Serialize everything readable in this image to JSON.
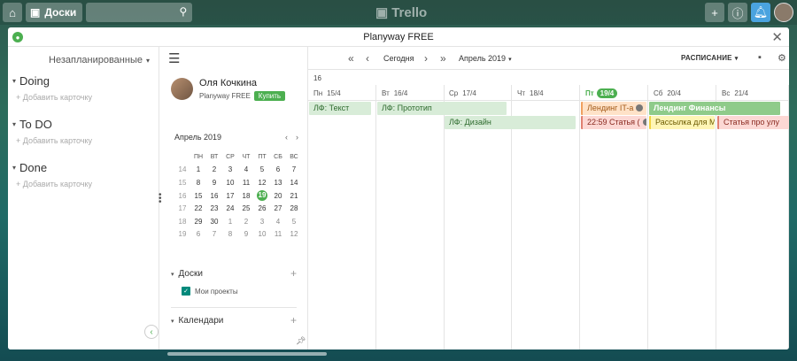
{
  "trello": {
    "boards_label": "Доски",
    "logo_text": "Trello"
  },
  "modal": {
    "title": "Planyway FREE"
  },
  "unscheduled": {
    "title": "Незапланированные",
    "lists": [
      {
        "name": "Doing",
        "add_card": "+ Добавить карточку"
      },
      {
        "name": "To DO",
        "add_card": "+ Добавить карточку"
      },
      {
        "name": "Done",
        "add_card": "+ Добавить карточку"
      }
    ]
  },
  "user": {
    "name": "Оля Кочкина",
    "plan": "Planyway FREE",
    "buy_label": "Купить"
  },
  "mini_calendar": {
    "month": "Апрель 2019",
    "day_names": [
      "ПН",
      "ВТ",
      "СР",
      "ЧТ",
      "ПТ",
      "СБ",
      "ВС"
    ],
    "today": "19",
    "weeks": [
      {
        "wk": "14",
        "days": [
          "1",
          "2",
          "3",
          "4",
          "5",
          "6",
          "7"
        ]
      },
      {
        "wk": "15",
        "days": [
          "8",
          "9",
          "10",
          "11",
          "12",
          "13",
          "14"
        ]
      },
      {
        "wk": "16",
        "days": [
          "15",
          "16",
          "17",
          "18",
          "19",
          "20",
          "21"
        ]
      },
      {
        "wk": "17",
        "days": [
          "22",
          "23",
          "24",
          "25",
          "26",
          "27",
          "28"
        ]
      },
      {
        "wk": "18",
        "days": [
          "29",
          "30",
          "1",
          "2",
          "3",
          "4",
          "5"
        ]
      },
      {
        "wk": "19",
        "days": [
          "6",
          "7",
          "8",
          "9",
          "10",
          "11",
          "12"
        ]
      }
    ]
  },
  "sidebar_sections": {
    "boards_label": "Доски",
    "my_projects": "Мои проекты",
    "calendars_label": "Календари"
  },
  "schedule": {
    "today_label": "Сегодня",
    "month_label": "Апрель 2019",
    "view_label": "РАСПИСАНИЕ",
    "week_number": "16",
    "days": [
      {
        "dow": "Пн",
        "date": "15/4"
      },
      {
        "dow": "Вт",
        "date": "16/4"
      },
      {
        "dow": "Ср",
        "date": "17/4"
      },
      {
        "dow": "Чт",
        "date": "18/4"
      },
      {
        "dow": "Пт",
        "date": "19/4",
        "today": true
      },
      {
        "dow": "Сб",
        "date": "20/4"
      },
      {
        "dow": "Вс",
        "date": "21/4"
      }
    ],
    "events": [
      {
        "text": "ЛФ: Текст",
        "style": "green"
      },
      {
        "text": "ЛФ: Прототип",
        "style": "green"
      },
      {
        "text": "ЛФ: Дизайн",
        "style": "green"
      },
      {
        "text": "Лендинг IT-а",
        "style": "orange"
      },
      {
        "text": "22:59 Статья (",
        "style": "red"
      },
      {
        "text": "Лендинг Финансы",
        "style": "green-strong"
      },
      {
        "text": "Рассылка для М",
        "style": "yellow"
      },
      {
        "text": "Статья про улу",
        "style": "red"
      }
    ]
  },
  "colors": {
    "accent": "#4caf50",
    "checkbox": "#00897b"
  }
}
